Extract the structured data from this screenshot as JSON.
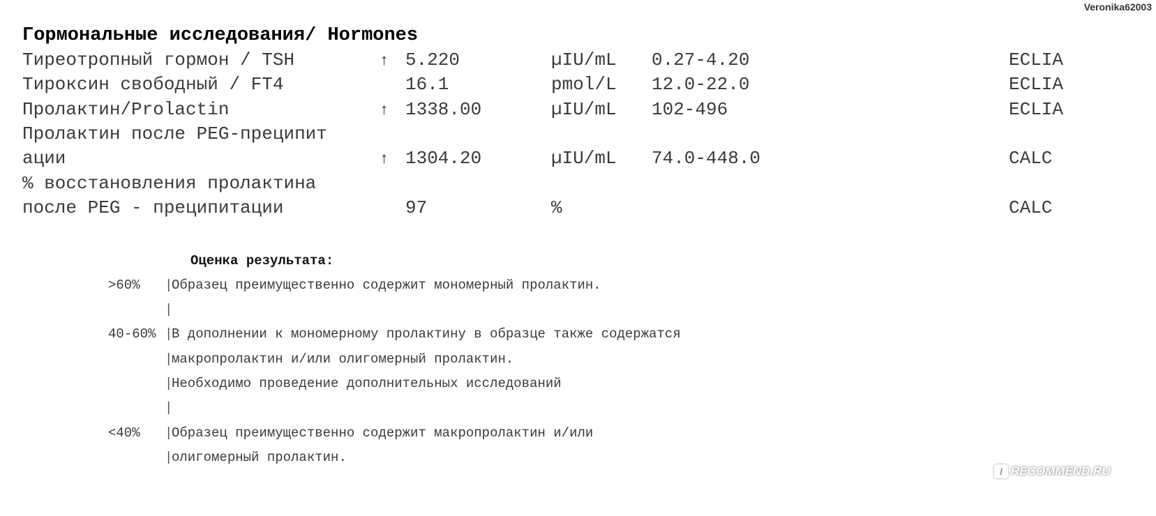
{
  "watermark_user": "Veronika62003",
  "section_title": "Гормональные исследования/ Hormones",
  "rows": [
    {
      "name": "Тиреотропный гормон / TSH",
      "flag": "↑",
      "value": "5.220",
      "unit": "µIU/mL",
      "reference": "0.27-4.20",
      "method": "ECLIA"
    },
    {
      "name": "Тироксин свободный / FT4",
      "flag": "",
      "value": "16.1",
      "unit": "pmol/L",
      "reference": "12.0-22.0",
      "method": "ECLIA"
    },
    {
      "name": "Пролактин/Prolactin",
      "flag": "↑",
      "value": "1338.00",
      "unit": "µIU/mL",
      "reference": "102-496",
      "method": "ECLIA"
    },
    {
      "name": "Пролактин после PEG-преципит",
      "flag": "",
      "value": "",
      "unit": "",
      "reference": "",
      "method": ""
    },
    {
      "name": "ации",
      "flag": "↑",
      "value": "1304.20",
      "unit": "µIU/mL",
      "reference": "74.0-448.0",
      "method": "CALC"
    },
    {
      "name": "% восстановления пролактина",
      "flag": "",
      "value": "",
      "unit": "",
      "reference": "",
      "method": ""
    },
    {
      "name": "после PEG - преципитации",
      "flag": "",
      "value": "97",
      "unit": "%",
      "reference": "",
      "method": "CALC"
    }
  ],
  "evaluation": {
    "title": "Оценка результата:",
    "lines": [
      {
        "range": ">60%",
        "bar": "|",
        "text": "Образец преимущественно содержит мономерный пролактин."
      },
      {
        "range": "",
        "bar": "|",
        "text": ""
      },
      {
        "range": "40-60%",
        "bar": "|",
        "text": "В дополнении к мономерному пролактину в образце также содержатся"
      },
      {
        "range": "",
        "bar": "|",
        "text": "макропролактин и/или олигомерный пролактин."
      },
      {
        "range": "",
        "bar": "|",
        "text": "Необходимо проведение дополнительных исследований"
      },
      {
        "range": "",
        "bar": "|",
        "text": ""
      },
      {
        "range": "<40%",
        "bar": "|",
        "text": "Образец преимущественно содержит макропролактин и/или"
      },
      {
        "range": "",
        "bar": "|",
        "text": "олигомерный пролактин."
      }
    ]
  },
  "watermark_site": "RECOMMEND.RU",
  "watermark_icon": "I"
}
